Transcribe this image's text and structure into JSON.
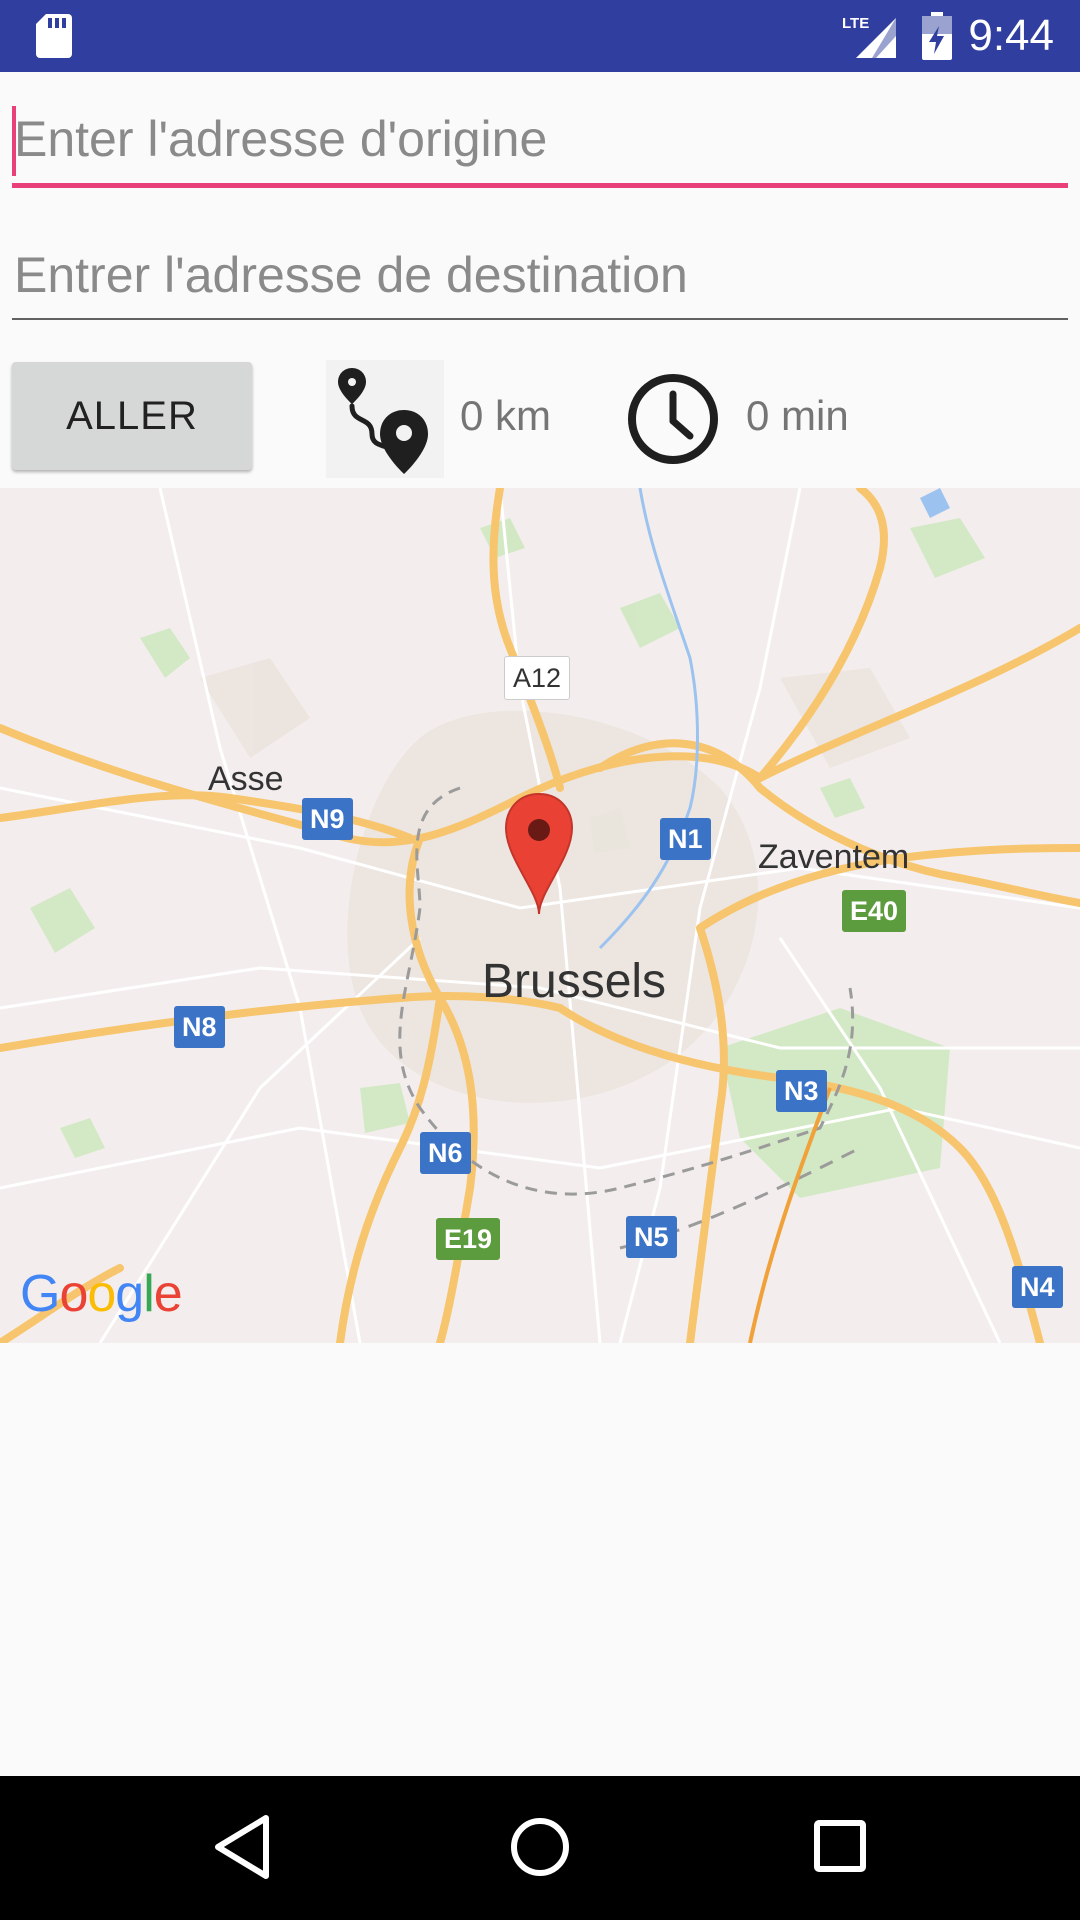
{
  "status_bar": {
    "time": "9:44",
    "network": "LTE",
    "icons": [
      "sd-card-icon",
      "lte-signal-icon",
      "battery-charging-icon"
    ]
  },
  "form": {
    "origin_placeholder": "Enter l'adresse d'origine",
    "destination_placeholder": "Entrer l'adresse de destination",
    "go_label": "ALLER"
  },
  "results": {
    "distance": "0 km",
    "duration": "0 min",
    "icons": [
      "route-icon",
      "clock-icon"
    ]
  },
  "map": {
    "city_label": "Brussels",
    "place_labels": [
      "Asse",
      "Zaventem"
    ],
    "road_shields": [
      "A12",
      "N9",
      "N1",
      "E40",
      "N8",
      "N3",
      "N6",
      "E19",
      "N5",
      "N4"
    ],
    "attribution": "Google"
  },
  "colors": {
    "status_bar": "#303f9f",
    "accent": "#e9407a",
    "button": "#d6d7d7",
    "marker": "#e94235"
  },
  "nav_bar": {
    "buttons": [
      "back-icon",
      "home-icon",
      "recents-icon"
    ]
  }
}
